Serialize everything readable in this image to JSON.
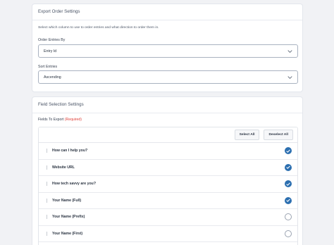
{
  "export_order": {
    "title": "Export Order Settings",
    "description": "Select which column to use to order entries and what direction to order them in.",
    "order_by": {
      "label": "Order Entries By",
      "value": "Entry Id"
    },
    "sort": {
      "label": "Sort Entries",
      "value": "Ascending"
    }
  },
  "field_selection": {
    "title": "Field Selection Settings",
    "fields_label": "Fields To Export",
    "required_label": "(Required)",
    "select_all_label": "Select All",
    "deselect_all_label": "Deselect All",
    "rows": [
      {
        "label": "How can I help you?",
        "checked": true
      },
      {
        "label": "Website URL",
        "checked": true
      },
      {
        "label": "How tech savvy are you?",
        "checked": true
      },
      {
        "label": "Your Name (Full)",
        "checked": true
      },
      {
        "label": "Your Name (Prefix)",
        "checked": false
      },
      {
        "label": "Your Name (First)",
        "checked": false
      }
    ]
  },
  "colors": {
    "accent": "#2c6fb0",
    "required": "#e0413a"
  }
}
